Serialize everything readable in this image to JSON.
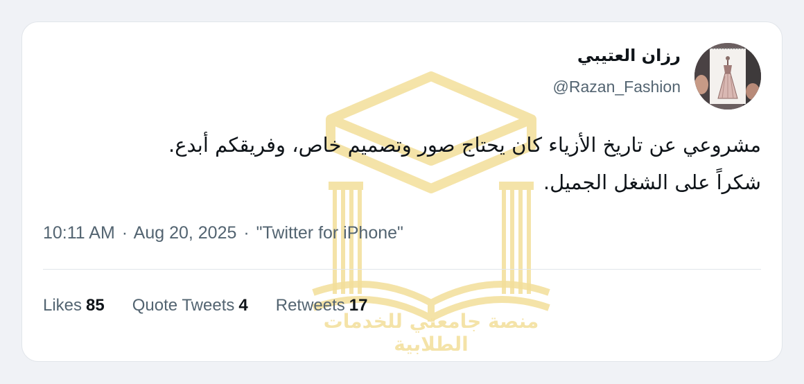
{
  "author": {
    "display_name": "رزان العتيبي",
    "handle": "@Razan_Fashion"
  },
  "tweet": {
    "lines": [
      "مشروعي عن تاريخ الأزياء كان يحتاج صور وتصميم خاص، وفريقكم أبدع.",
      "شكراً على الشغل الجميل."
    ]
  },
  "meta": {
    "time": "10:11 AM",
    "date": "Aug 20, 2025",
    "source": "\"Twitter for iPhone\""
  },
  "stats": [
    {
      "label": "Likes",
      "value": "85"
    },
    {
      "label": "Quote Tweets",
      "value": "4"
    },
    {
      "label": "Retweets",
      "value": "17"
    }
  ],
  "watermark": {
    "text": "منصة جامعتي للخدمات الطلابية"
  },
  "colors": {
    "text_primary": "#0f1419",
    "text_secondary": "#536471",
    "watermark": "#f3df9a",
    "divider": "#e1e5ea",
    "background": "#f0f2f6"
  },
  "icons": {
    "avatar": "fashion-sketch-avatar",
    "watermark_logo": "graduation-cap-book-logo"
  }
}
